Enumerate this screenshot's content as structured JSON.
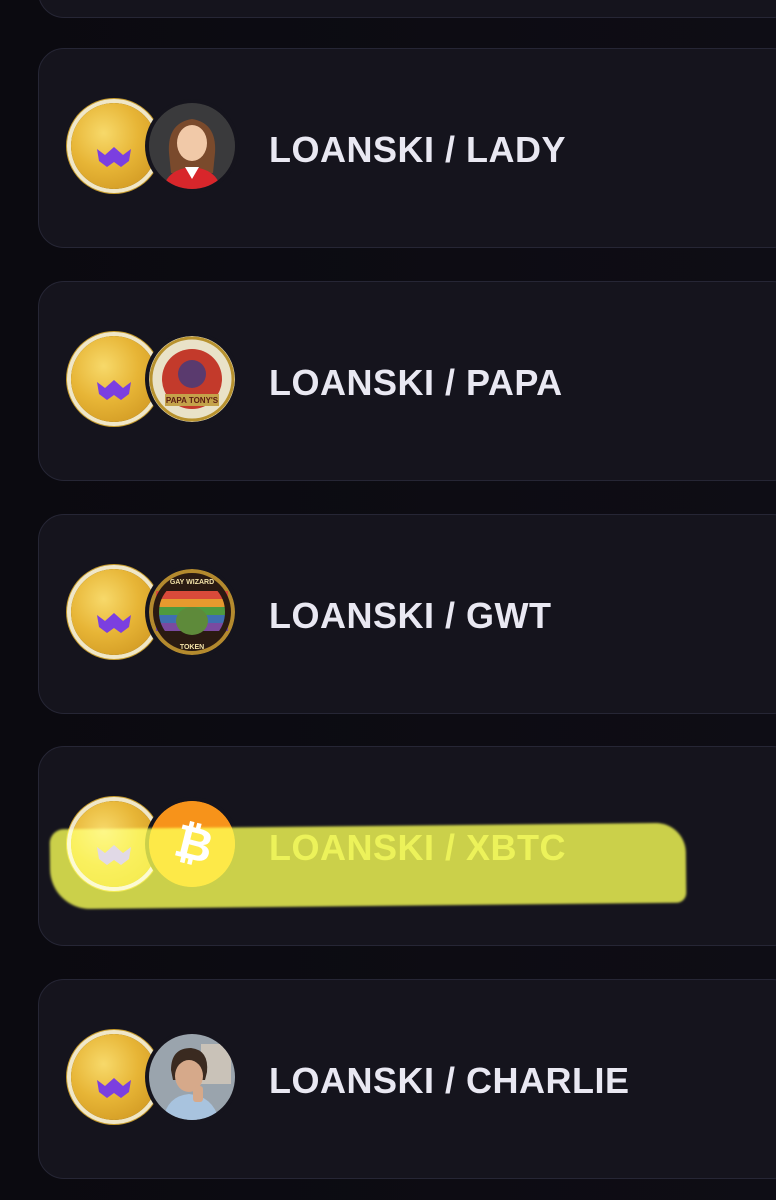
{
  "pairs": [
    {
      "label": "LOANSKI / LADY",
      "price_peek": "$",
      "partner_icon": "lady-avatar-icon"
    },
    {
      "label": "LOANSKI / PAPA",
      "price_peek": "$",
      "partner_icon": "papa-tonys-icon"
    },
    {
      "label": "LOANSKI / GWT",
      "price_peek": "$",
      "partner_icon": "gay-wizard-token-icon"
    },
    {
      "label": "LOANSKI / XBTC",
      "price_peek": "$",
      "partner_icon": "bitcoin-icon",
      "highlighted": true
    },
    {
      "label": "LOANSKI / CHARLIE",
      "price_peek": "$",
      "partner_icon": "charlie-avatar-icon"
    }
  ],
  "partner_coin_text": {
    "papa_ring": "BETTER BLOCKCHAIN. BETTER CRYPTO.",
    "papa_name": "PAPA TONY'S",
    "gwt_ring": "GAY WIZARD",
    "gwt_bottom": "TOKEN"
  },
  "colors": {
    "background": "#0c0b12",
    "card": "#15141d",
    "card_border": "#262635",
    "text": "#e9e8f2",
    "highlight": "#e9f03b",
    "loanski_gold": "#e7b536",
    "loanski_mouth": "#7b3fe0",
    "bitcoin_orange": "#f7931a"
  }
}
